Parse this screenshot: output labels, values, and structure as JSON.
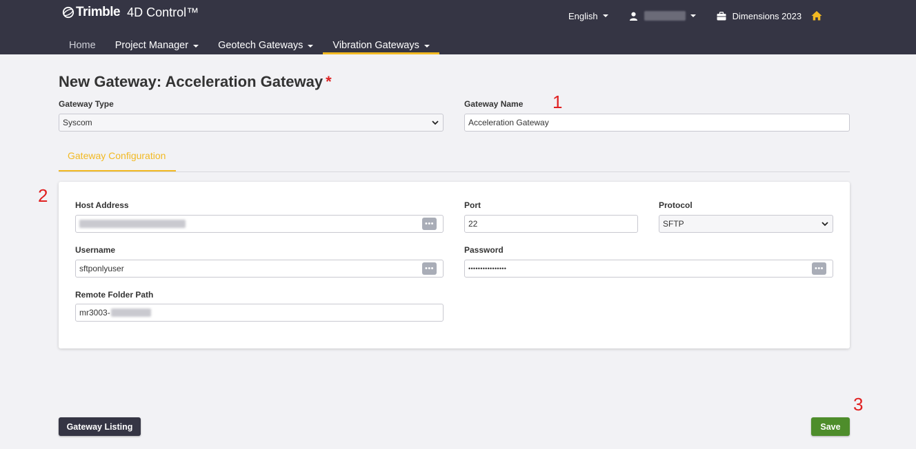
{
  "header": {
    "brand": "Trimble",
    "product": "4D Control™",
    "language": "English",
    "project": "Dimensions 2023",
    "icons": {
      "user": "user-icon",
      "project": "briefcase-icon",
      "home": "home-icon",
      "brand": "trimble-globe-icon"
    }
  },
  "nav": {
    "items": [
      {
        "label": "Home"
      },
      {
        "label": "Project Manager"
      },
      {
        "label": "Geotech Gateways"
      },
      {
        "label": "Vibration Gateways"
      }
    ]
  },
  "page": {
    "title": "New Gateway: Acceleration Gateway",
    "required_mark": "*"
  },
  "form": {
    "gateway_type_label": "Gateway Type",
    "gateway_type_value": "Syscom",
    "gateway_name_label": "Gateway Name",
    "gateway_name_value": "Acceleration Gateway"
  },
  "tabs": [
    {
      "label": "Gateway Configuration"
    }
  ],
  "config": {
    "host_address_label": "Host Address",
    "port_label": "Port",
    "port_value": "22",
    "protocol_label": "Protocol",
    "protocol_value": "SFTP",
    "username_label": "Username",
    "username_value": "sftponlyuser",
    "password_label": "Password",
    "password_value": "••••••••••••••••",
    "remote_folder_label": "Remote Folder Path",
    "remote_folder_value": "mr3003-"
  },
  "annotations": [
    "1",
    "2",
    "3"
  ],
  "buttons": {
    "listing": "Gateway Listing",
    "save": "Save",
    "field_action_glyph": "•••"
  },
  "colors": {
    "header_bg": "#353544",
    "accent": "#f2b922",
    "save_green": "#4e8d2b",
    "annotation_red": "#e02020"
  }
}
